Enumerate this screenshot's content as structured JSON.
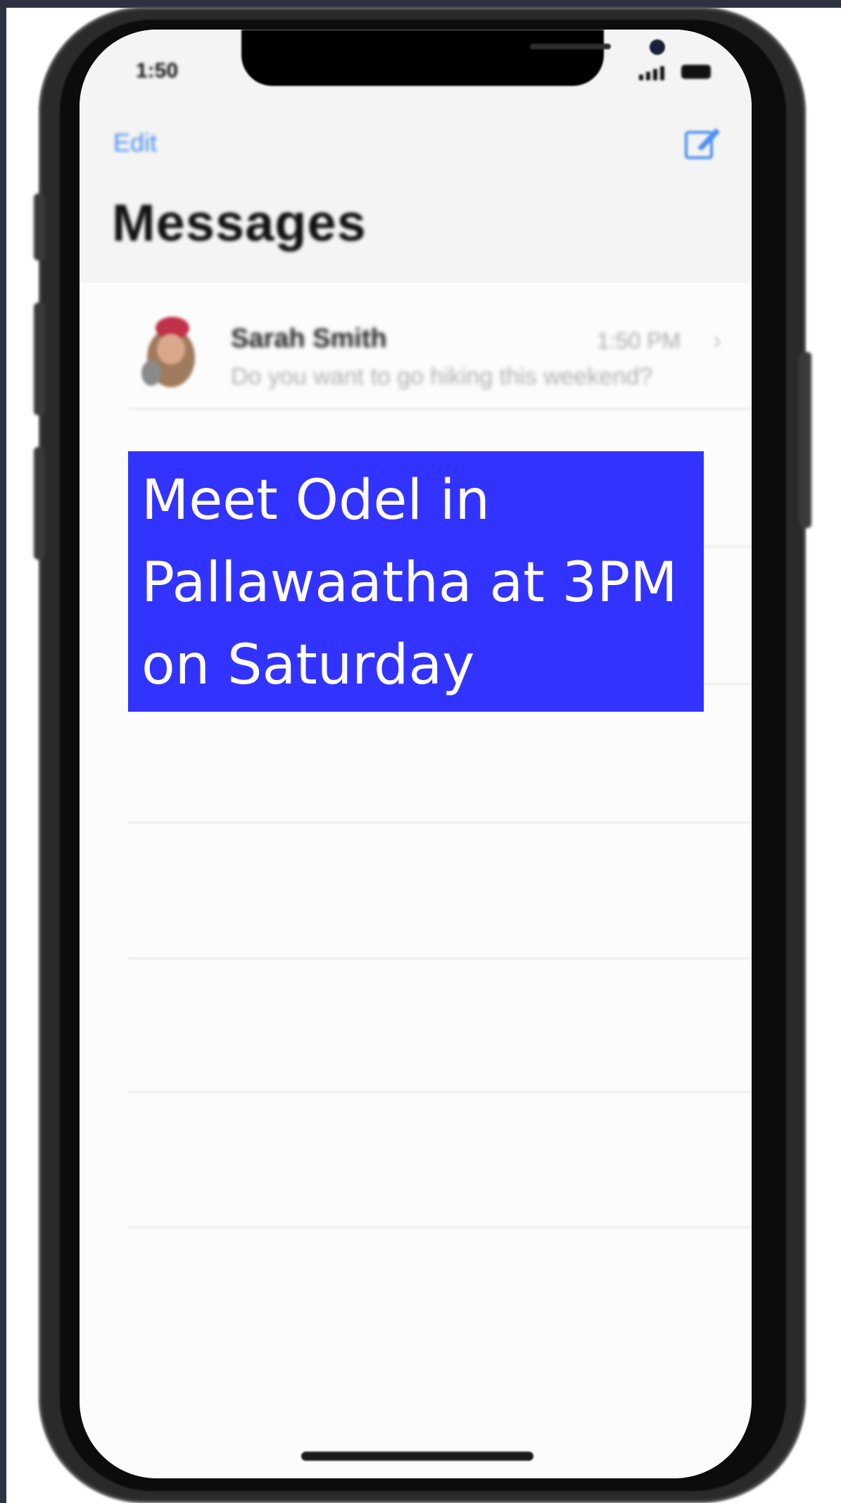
{
  "status_bar": {
    "time": "1:50"
  },
  "nav": {
    "edit_label": "Edit",
    "title": "Messages",
    "compose_icon": "compose-icon"
  },
  "conversations": [
    {
      "sender": "Sarah Smith",
      "time": "1:50 PM",
      "preview": "Do you want to go hiking this weekend?"
    }
  ],
  "banner": {
    "text": "Meet Odel in Pallawaatha at 3PM on Saturday",
    "color": "#3333ff",
    "text_color": "#ffffff"
  },
  "colors": {
    "accent": "#4a8ff0",
    "frame": "#2a2a2a",
    "screen": "#fcfcfc"
  }
}
